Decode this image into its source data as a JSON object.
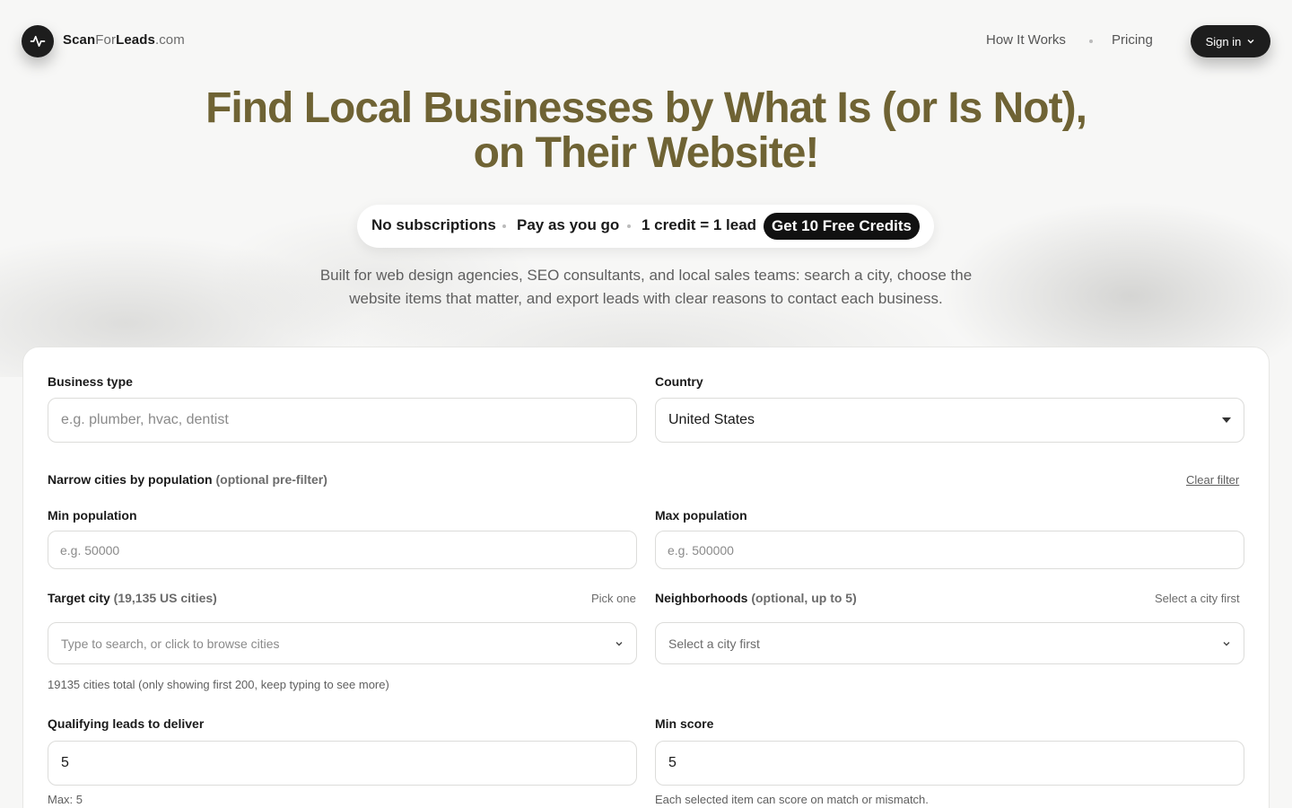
{
  "header": {
    "brand": {
      "scan": "Scan",
      "for": "For",
      "leads": "Leads",
      "tld": ".com"
    },
    "nav": {
      "how_it_works": "How It Works",
      "pricing": "Pricing"
    },
    "sign_in": "Sign in",
    "icons": {
      "logo": "activity-pulse-icon",
      "sign_in_chevron": "chevron-down-icon"
    }
  },
  "hero": {
    "title_line1": "Find Local Businesses by What Is (or Is Not),",
    "title_line2": "on Their Website!",
    "pill": {
      "no_subscriptions": "No subscriptions",
      "pay_as_you_go": "Pay as you go",
      "credit_lead": "1 credit = 1 lead",
      "cta": "Get 10 Free Credits"
    },
    "subtitle_line1": "Built for web design agencies, SEO consultants, and local sales teams: search a city, choose the",
    "subtitle_line2": "website items that matter, and export leads with clear reasons to contact each business."
  },
  "form": {
    "business_type": {
      "label": "Business type",
      "placeholder": "e.g. plumber, hvac, dentist"
    },
    "country": {
      "label": "Country",
      "value": "United States"
    },
    "narrow": {
      "label": "Narrow cities by population",
      "hint": "(optional pre-filter)",
      "clear": "Clear filter"
    },
    "min_population": {
      "label": "Min population",
      "placeholder": "e.g. 50000"
    },
    "max_population": {
      "label": "Max population",
      "placeholder": "e.g. 500000"
    },
    "target_city": {
      "label": "Target city",
      "count": "(19,135 US cities)",
      "note": "Pick one",
      "placeholder": "Type to search, or click to browse cities",
      "help": "19135 cities total (only showing first 200, keep typing to see more)"
    },
    "neighborhoods": {
      "label": "Neighborhoods",
      "hint": "(optional, up to 5)",
      "note": "Select a city first",
      "placeholder": "Select a city first"
    },
    "qualifying_leads": {
      "label": "Qualifying leads to deliver",
      "value": "5",
      "help": "Max: 5"
    },
    "min_score": {
      "label": "Min score",
      "value": "5",
      "help": "Each selected item can score on match or mismatch."
    }
  },
  "colors": {
    "title": "#6f6334",
    "dark": "#1d1d1d",
    "background": "#f7f7f6"
  }
}
